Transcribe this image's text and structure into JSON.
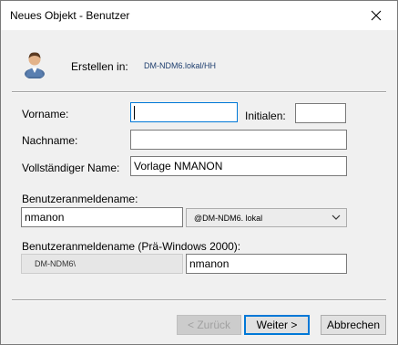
{
  "dialog": {
    "title": "Neues Objekt - Benutzer",
    "create_in_label": "Erstellen in:",
    "create_in_path": "DM-NDM6.lokal/HH"
  },
  "form": {
    "first_name_label": "Vorname:",
    "first_name_value": "",
    "initials_label": "Initialen:",
    "initials_value": "",
    "last_name_label": "Nachname:",
    "last_name_value": "",
    "full_name_label": "Vollständiger Name:",
    "full_name_value": "Vorlage NMANON",
    "logon_name_label": "Benutzeranmeldename:",
    "logon_name_value": "nmanon",
    "domain_suffix": "@DM-NDM6. lokal",
    "pre2000_label": "Benutzeranmeldename (Prä-Windows 2000):",
    "pre2000_domain": "DM-NDM6\\",
    "pre2000_value": "nmanon"
  },
  "buttons": {
    "back": "< Zurück",
    "next": "Weiter >",
    "cancel": "Abbrechen"
  },
  "icons": {
    "avatar": "user-icon",
    "close": "close-icon",
    "dropdown": "chevron-down-icon"
  }
}
